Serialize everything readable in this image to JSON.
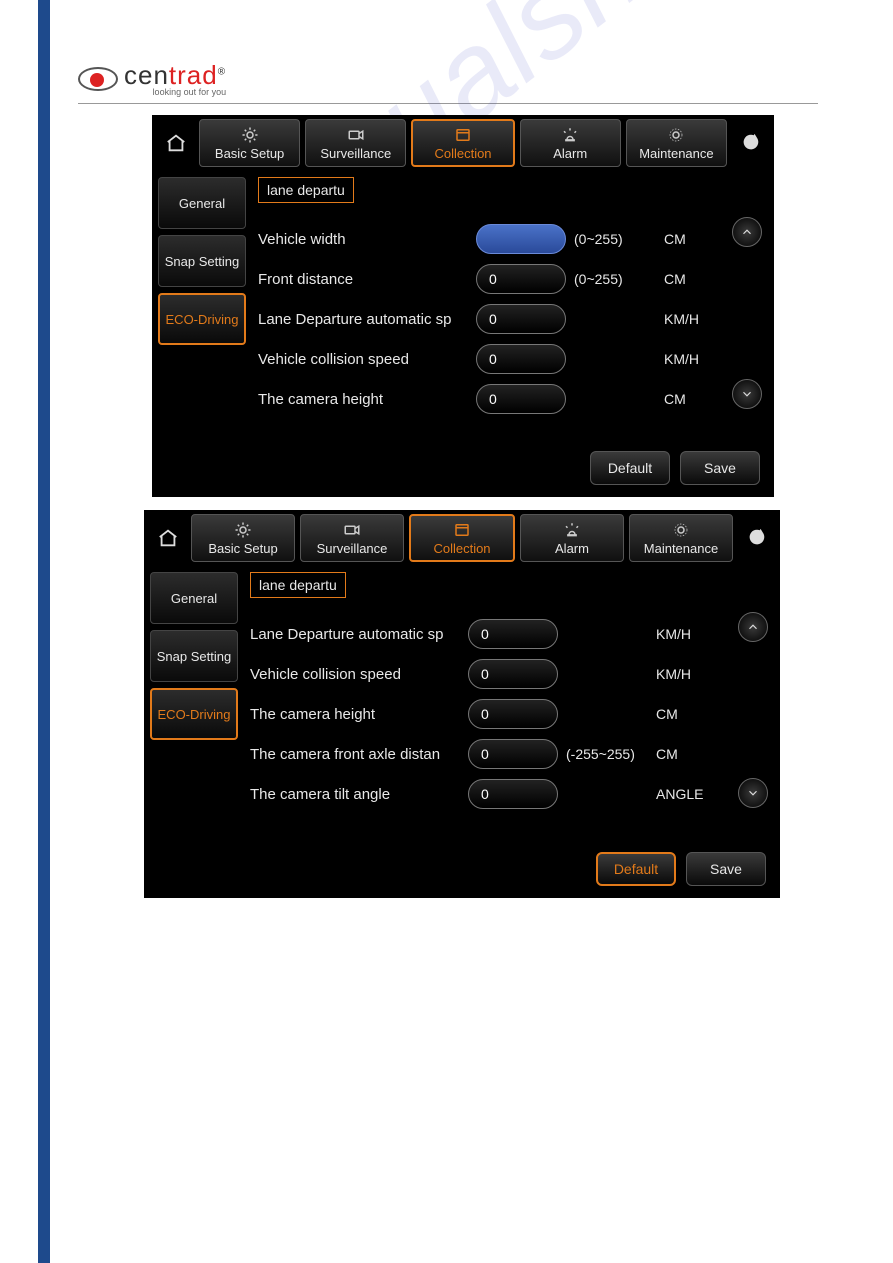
{
  "logo": {
    "brand_pre": "cen",
    "brand_post": "trad",
    "tagline": "looking out for you"
  },
  "watermark": "manualshive.com",
  "common": {
    "tabs": [
      {
        "label": "Basic Setup"
      },
      {
        "label": "Surveillance"
      },
      {
        "label": "Collection"
      },
      {
        "label": "Alarm"
      },
      {
        "label": "Maintenance"
      }
    ],
    "sidebar": [
      {
        "label": "General"
      },
      {
        "label": "Snap Setting"
      },
      {
        "label": "ECO-Driving"
      }
    ],
    "subtab": "lane departu",
    "buttons": {
      "default": "Default",
      "save": "Save"
    }
  },
  "screen1": {
    "rows": [
      {
        "label": "Vehicle width",
        "value": "",
        "range": "(0~255)",
        "unit": "CM",
        "focused": true
      },
      {
        "label": "Front distance",
        "value": "0",
        "range": "(0~255)",
        "unit": "CM"
      },
      {
        "label": "Lane Departure automatic sp",
        "value": "0",
        "range": "",
        "unit": "KM/H"
      },
      {
        "label": "Vehicle collision speed",
        "value": "0",
        "range": "",
        "unit": "KM/H"
      },
      {
        "label": "The camera height",
        "value": "0",
        "range": "",
        "unit": "CM"
      }
    ],
    "default_highlight": false
  },
  "screen2": {
    "rows": [
      {
        "label": "Lane Departure automatic sp",
        "value": "0",
        "range": "",
        "unit": "KM/H"
      },
      {
        "label": "Vehicle collision speed",
        "value": "0",
        "range": "",
        "unit": "KM/H"
      },
      {
        "label": "The camera height",
        "value": "0",
        "range": "",
        "unit": "CM"
      },
      {
        "label": "The camera front axle distan",
        "value": "0",
        "range": "(-255~255)",
        "unit": "CM"
      },
      {
        "label": "The camera tilt angle",
        "value": "0",
        "range": "",
        "unit": "ANGLE"
      }
    ],
    "default_highlight": true
  }
}
